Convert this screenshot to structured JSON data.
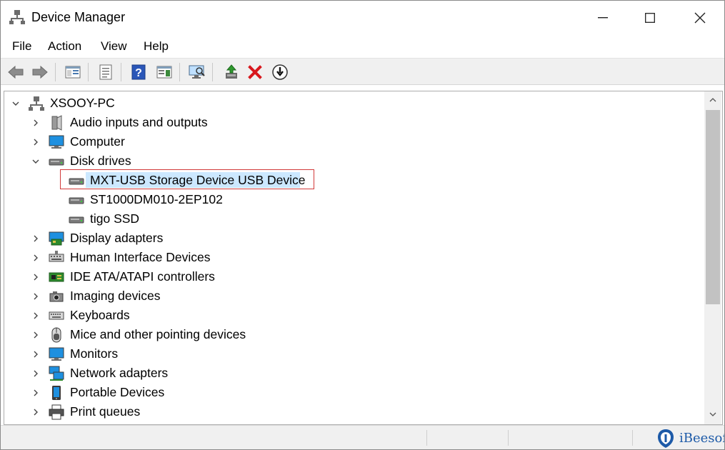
{
  "window": {
    "title": "Device Manager"
  },
  "menu": [
    "File",
    "Action",
    "View",
    "Help"
  ],
  "toolbar": {
    "buttons": [
      "back-arrow-icon",
      "forward-arrow-icon",
      "show-hide-console-tree-icon",
      "properties-icon",
      "help-icon",
      "action-pane-icon",
      "scan-hardware-changes-icon",
      "update-driver-icon",
      "uninstall-device-icon",
      "disable-device-icon"
    ]
  },
  "tree": {
    "root": {
      "label": "XSOOY-PC",
      "expanded": true
    },
    "items": [
      {
        "label": "Audio inputs and outputs",
        "icon": "speaker-icon",
        "expanded": false
      },
      {
        "label": "Computer",
        "icon": "computer-icon",
        "expanded": false
      },
      {
        "label": "Disk drives",
        "icon": "disk-drive-icon",
        "expanded": true,
        "children": [
          {
            "label": "MXT-USB Storage Device USB Device",
            "selected": true
          },
          {
            "label": "ST1000DM010-2EP102"
          },
          {
            "label": "tigo SSD"
          }
        ]
      },
      {
        "label": "Display adapters",
        "icon": "display-adapter-icon",
        "expanded": false
      },
      {
        "label": "Human Interface Devices",
        "icon": "hid-icon",
        "expanded": false
      },
      {
        "label": "IDE ATA/ATAPI controllers",
        "icon": "ide-controller-icon",
        "expanded": false
      },
      {
        "label": "Imaging devices",
        "icon": "camera-icon",
        "expanded": false
      },
      {
        "label": "Keyboards",
        "icon": "keyboard-icon",
        "expanded": false
      },
      {
        "label": "Mice and other pointing devices",
        "icon": "mouse-icon",
        "expanded": false
      },
      {
        "label": "Monitors",
        "icon": "monitor-icon",
        "expanded": false
      },
      {
        "label": "Network adapters",
        "icon": "network-icon",
        "expanded": false
      },
      {
        "label": "Portable Devices",
        "icon": "portable-device-icon",
        "expanded": false
      },
      {
        "label": "Print queues",
        "icon": "printer-icon",
        "expanded": false
      }
    ]
  },
  "watermark": {
    "text": "iBeesoft"
  },
  "colors": {
    "selection": "#cce8ff",
    "highlight_border": "#d23a3a",
    "accent": "#1d5aa8"
  }
}
